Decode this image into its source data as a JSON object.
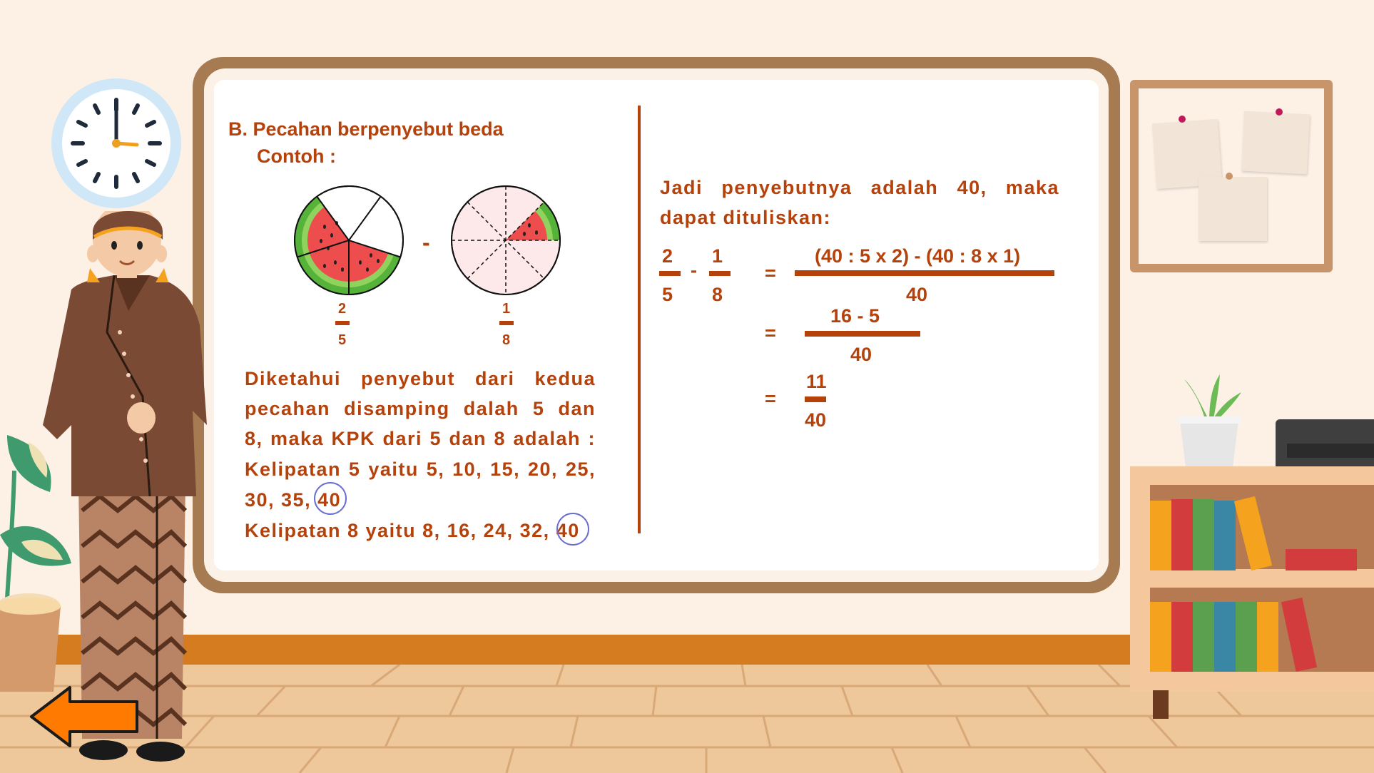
{
  "board": {
    "heading": "B. Pecahan berpenyebut beda",
    "example_label": "Contoh :",
    "minus_sign": "-",
    "fraction_left": {
      "numerator": "2",
      "denominator": "5"
    },
    "fraction_right": {
      "numerator": "1",
      "denominator": "8"
    },
    "explanation_lines": [
      "Diketahui penyebut dari kedua",
      "pecahan disamping dalah 5 dan",
      "8, maka KPK dari 5 dan 8 adalah :",
      "Kelipatan 5 yaitu 5, 10, 15, 20, 25,",
      "30, 35, 40",
      "Kelipatan 8 yaitu 8, 16, 24, 32, 40"
    ],
    "conclusion_lines": [
      "Jadi penyebutnya adalah 40, maka",
      "dapat dituliskan:"
    ],
    "equation": {
      "left_numerator_1": "2",
      "left_denominator_1": "5",
      "operator": "-",
      "left_numerator_2": "1",
      "left_denominator_2": "8",
      "equals": "=",
      "step1_numerator": "(40 : 5 x 2) - (40 : 8 x 1)",
      "step1_denominator": "40",
      "step2_numerator": "16 - 5",
      "step2_denominator": "40",
      "result_numerator": "11",
      "result_denominator": "40"
    }
  },
  "colors": {
    "text_accent": "#b5420b",
    "board_frame": "#a67b52",
    "baseboard": "#d47c1f",
    "floor": "#eec79b",
    "back_arrow": "#ff7a00"
  },
  "icons": {
    "clock": "clock-icon",
    "back": "back-arrow-icon"
  }
}
